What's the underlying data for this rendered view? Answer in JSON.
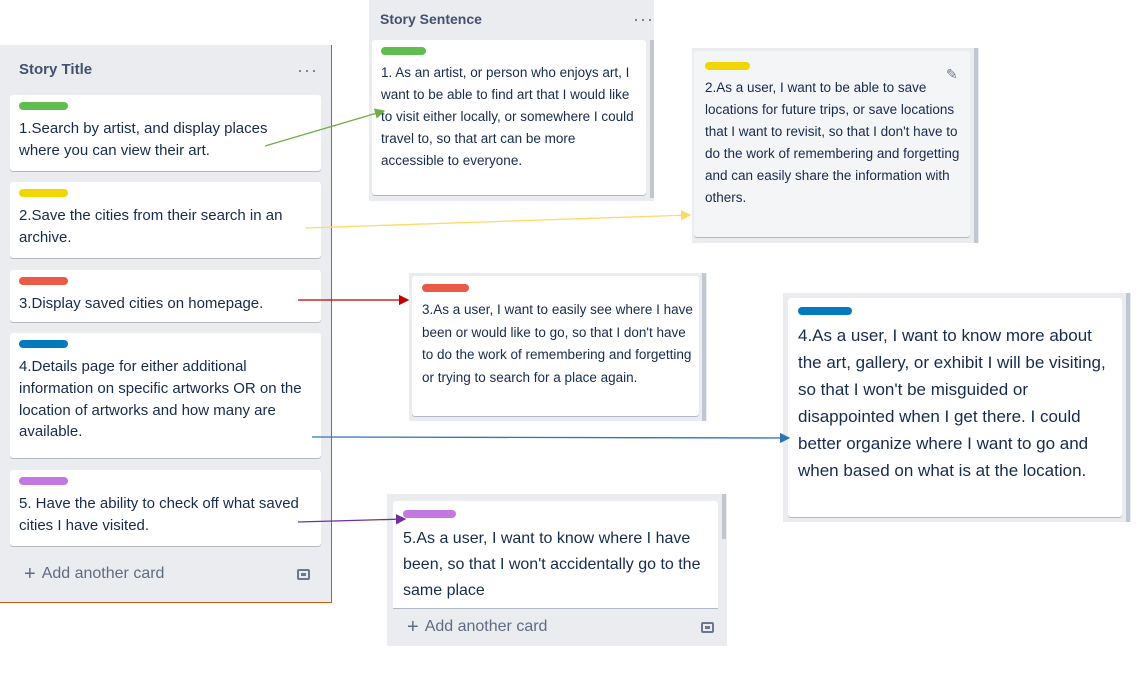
{
  "story_title_list": {
    "title": "Story Title",
    "menu": "···",
    "cards": [
      {
        "label_color": "#61bd4f",
        "text": "1.Search by artist, and display places where you can view their art."
      },
      {
        "label_color": "#f2d600",
        "text": "2.Save the cities from their search in an archive."
      },
      {
        "label_color": "#eb5a46",
        "text": "3.Display saved cities on homepage."
      },
      {
        "label_color": "#0079bf",
        "text": "4.Details page for either additional information on specific artworks OR on the location of artworks and how many are available."
      },
      {
        "label_color": "#c377e0",
        "text": "5. Have the ability to check off what saved cities I have visited."
      }
    ],
    "add_card": "Add another card"
  },
  "story_sentence_list": {
    "title": "Story Sentence",
    "menu": "···",
    "card": {
      "label_color": "#61bd4f",
      "text": "1. As an artist, or person who enjoys art, I want to be able to find art that I would like to visit either locally, or somewhere I could travel to, so that art can be more accessible to everyone."
    }
  },
  "sentence_card_2": {
    "label_color": "#f2d600",
    "text": "2.As a user, I want to be able to save locations for future trips, or save locations that I want to revisit, so that I don't have to do the work of remembering and forgetting and can easily share the information with others.",
    "edit_icon": "pencil-icon"
  },
  "sentence_card_3": {
    "label_color": "#eb5a46",
    "text": "3.As a user, I want to easily see where I have been or would like to go, so that I don't have to do the work of remembering and forgetting or trying to search for a place again."
  },
  "sentence_card_4": {
    "label_color": "#0079bf",
    "text": "4.As a user, I want to know more about the art, gallery, or exhibit I will be visiting, so that I won't be misguided or disappointed when I get there. I could better organize where I want to go and when based on what is at the location."
  },
  "sentence_card_5": {
    "label_color": "#c377e0",
    "text": "5.As a user, I want to know where I have been, so that I won't accidentally go to the same place",
    "add_card": "Add another card"
  },
  "arrow_colors": {
    "green": "#70ad47",
    "yellow": "#ffd966",
    "red": "#c00000",
    "blue": "#2e75b6",
    "purple": "#7030a0"
  }
}
